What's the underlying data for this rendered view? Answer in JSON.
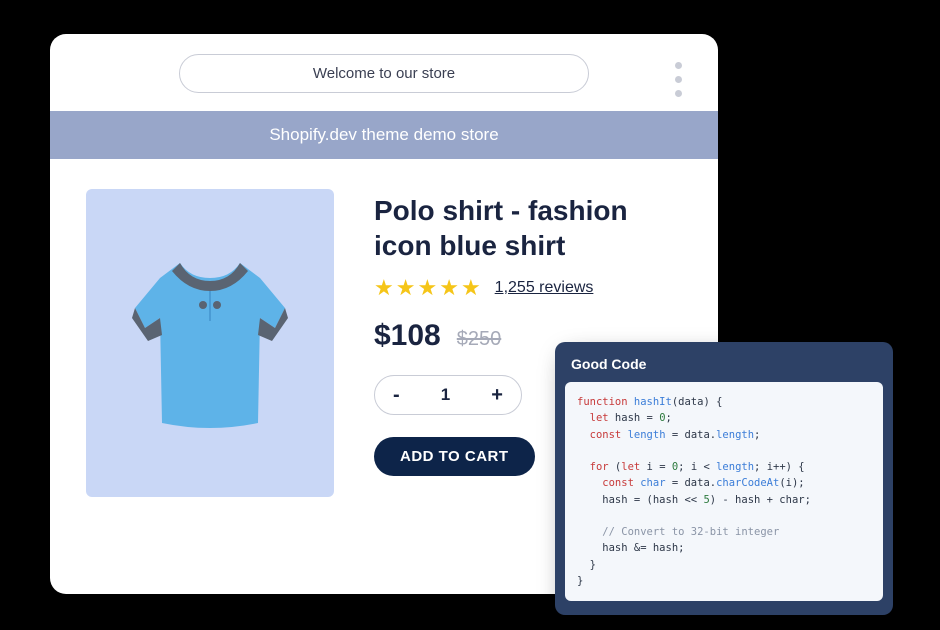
{
  "header": {
    "welcome_text": "Welcome to our store"
  },
  "banner": {
    "text": "Shopify.dev theme demo store"
  },
  "product": {
    "title": "Polo shirt - fashion icon blue shirt",
    "reviews_count": "1,255 reviews",
    "price": "$108",
    "compare_price": "$250",
    "quantity": "1",
    "add_to_cart_label": "ADD TO CART"
  },
  "code_panel": {
    "title": "Good Code",
    "lines": {
      "l1a": "function",
      "l1b": " hashIt",
      "l1c": "(data) {",
      "l2a": "  let",
      "l2b": " hash = ",
      "l2c": "0",
      "l2d": ";",
      "l3a": "  const",
      "l3b": " length",
      "l3c": " = data.",
      "l3d": "length",
      "l3e": ";",
      "l4": "",
      "l5a": "  for",
      "l5b": " (",
      "l5c": "let",
      "l5d": " i = ",
      "l5e": "0",
      "l5f": "; i < ",
      "l5g": "length",
      "l5h": "; i++) {",
      "l6a": "    const",
      "l6b": " char",
      "l6c": " = data.",
      "l6d": "charCodeAt",
      "l6e": "(i);",
      "l7a": "    hash = (hash << ",
      "l7b": "5",
      "l7c": ") - hash + char;",
      "l8": "",
      "l9": "    // Convert to 32-bit integer",
      "l10": "    hash &= hash;",
      "l11": "  }",
      "l12": "}"
    }
  }
}
